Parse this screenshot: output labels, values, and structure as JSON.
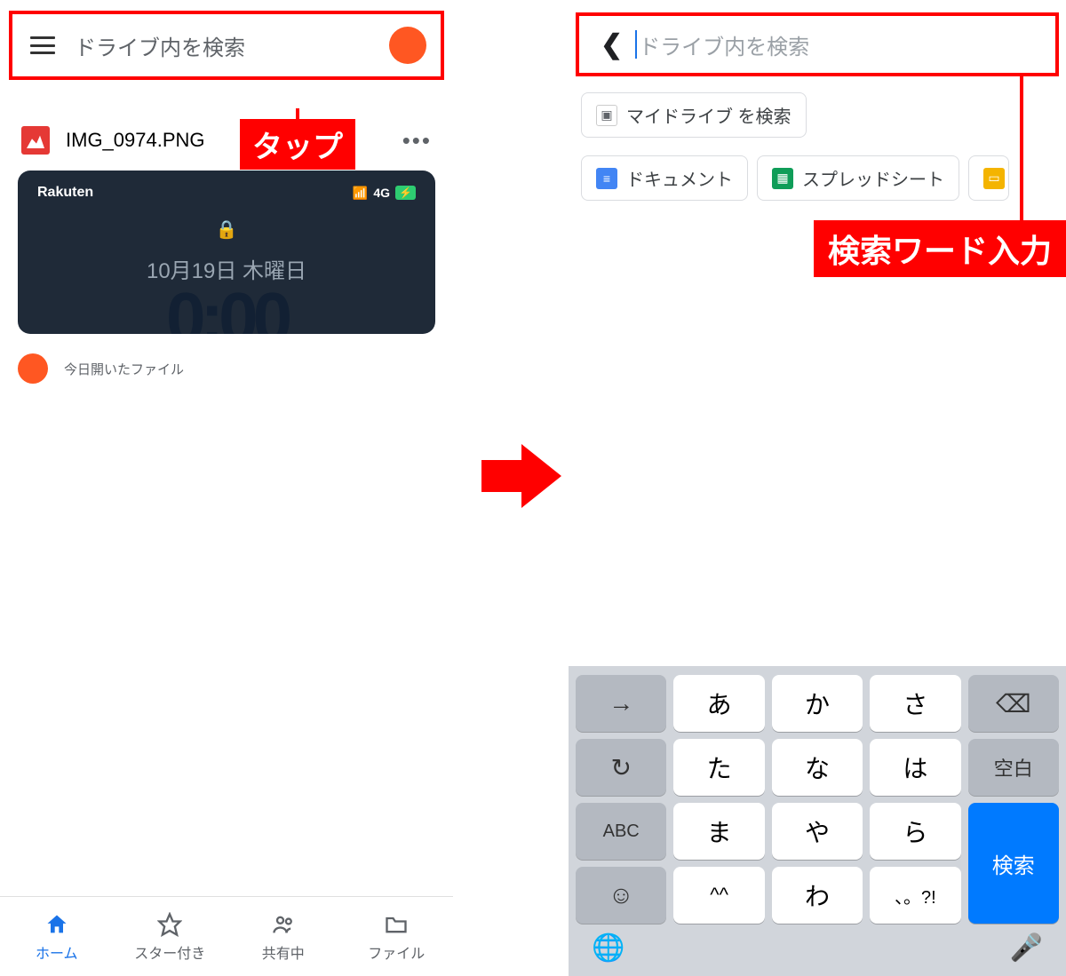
{
  "left": {
    "search_placeholder": "ドライブ内を検索",
    "callout_tap": "タップ",
    "file": {
      "name": "IMG_0974.PNG",
      "thumb_carrier": "Rakuten",
      "thumb_signal": "4G",
      "thumb_date": "10月19日 木曜日"
    },
    "legend": "今日開いたファイル",
    "nav": {
      "home": "ホーム",
      "starred": "スター付き",
      "shared": "共有中",
      "files": "ファイル"
    }
  },
  "right": {
    "search_placeholder": "ドライブ内を検索",
    "callout_input": "検索ワード入力",
    "chips": {
      "mydrive": "マイドライブ を検索",
      "docs": "ドキュメント",
      "sheets": "スプレッドシート"
    },
    "keyboard": {
      "r1": {
        "k1": "→",
        "k2": "あ",
        "k3": "か",
        "k4": "さ",
        "k5": "⌫"
      },
      "r2": {
        "k1": "↻",
        "k2": "た",
        "k3": "な",
        "k4": "は",
        "k5": "空白"
      },
      "r3": {
        "k1": "ABC",
        "k2": "ま",
        "k3": "や",
        "k4": "ら",
        "k5": "検索"
      },
      "r4": {
        "k1": "☺",
        "k2": "^^",
        "k3": "わ",
        "k4": "、。?!"
      }
    }
  }
}
